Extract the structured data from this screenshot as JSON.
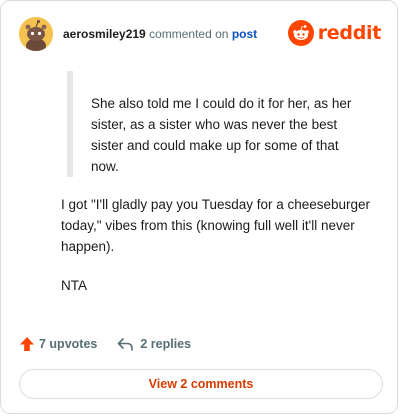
{
  "comment": {
    "author": "aerosmiley219",
    "action_text": "commented on",
    "post_link": "post",
    "quote": "She also told me I could do it for her, as her sister, as a sister who was never the best sister and could make up for some of that now.",
    "paragraphs": [
      "I got \"I'll gladly pay you Tuesday for a cheeseburger today,\" vibes from this (knowing full well it'll never happen).",
      "NTA"
    ]
  },
  "brand": {
    "name": "reddit",
    "icon": "reddit-alien-icon",
    "color": "#ff4500"
  },
  "avatar": {
    "icon": "snoo-avatar-icon",
    "background": "#f4c24e"
  },
  "stats": {
    "upvotes": "7 upvotes",
    "upvote_icon": "arrow-up-icon",
    "upvote_color": "#ff4500",
    "replies": "2 replies",
    "reply_icon": "reply-arrow-icon"
  },
  "footer": {
    "view_comments": "View 2 comments",
    "link_color": "#d93a00"
  }
}
